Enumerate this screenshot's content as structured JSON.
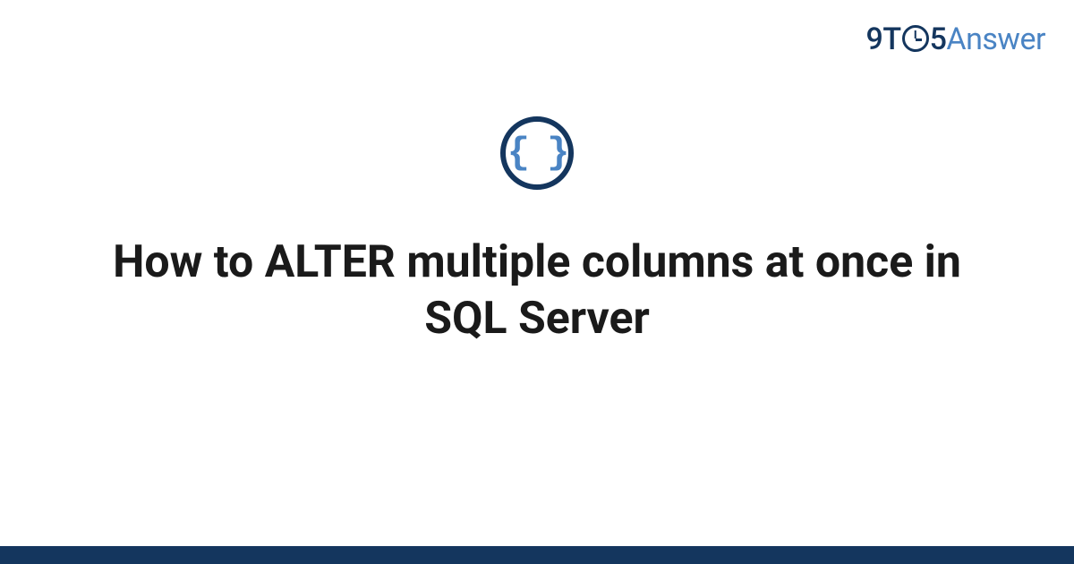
{
  "logo": {
    "part1": "9T",
    "part2": "5",
    "part3": "Answer"
  },
  "icon": {
    "braces": "{ }"
  },
  "title": "How to ALTER multiple columns at once in SQL Server"
}
